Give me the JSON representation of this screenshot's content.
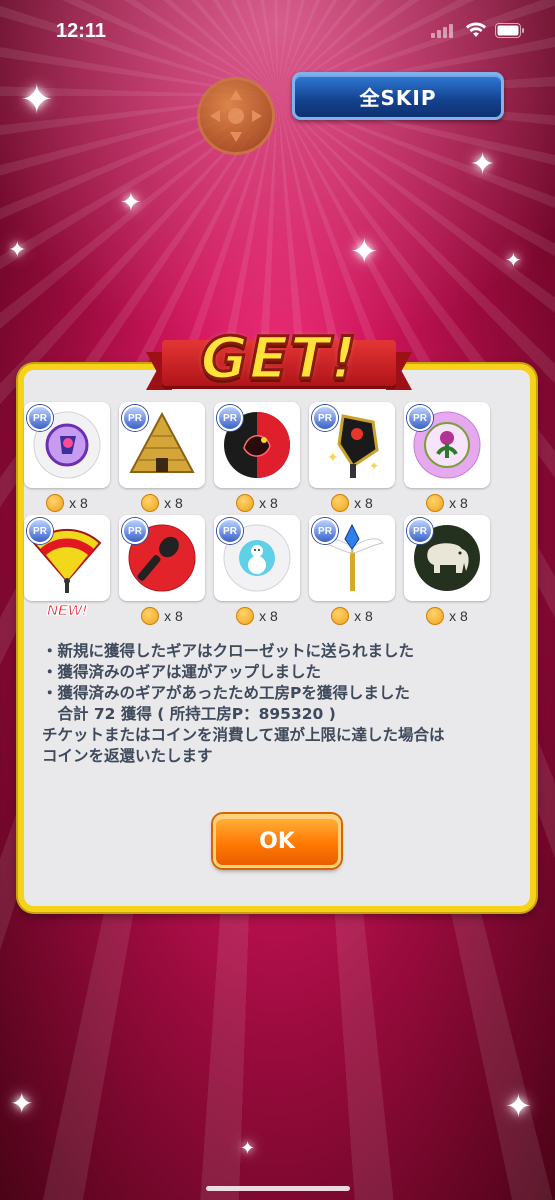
{
  "status_bar": {
    "time": "12:11"
  },
  "top": {
    "skip_label": "全SKIP"
  },
  "banner": {
    "text": "GET!"
  },
  "items": [
    {
      "icon": "golf-ball-purple-crest-icon",
      "badge": "PR",
      "coin_text": "x 8",
      "is_new": false
    },
    {
      "icon": "pyramid-icon",
      "badge": "PR",
      "coin_text": "x 8",
      "is_new": false
    },
    {
      "icon": "golf-ball-red-black-rooster-icon",
      "badge": "PR",
      "coin_text": "x 8",
      "is_new": false
    },
    {
      "icon": "golf-club-driver-icon",
      "badge": "PR",
      "coin_text": "x 8",
      "is_new": false
    },
    {
      "icon": "golf-ball-thistle-icon",
      "badge": "PR",
      "coin_text": "x 8",
      "is_new": false
    },
    {
      "icon": "folding-fan-icon",
      "badge": "PR",
      "coin_text": "",
      "is_new": true,
      "new_label": "NEW!"
    },
    {
      "icon": "golf-ball-microphone-icon",
      "badge": "PR",
      "coin_text": "x 8",
      "is_new": false
    },
    {
      "icon": "golf-ball-snowman-icon",
      "badge": "PR",
      "coin_text": "x 8",
      "is_new": false
    },
    {
      "icon": "winged-wand-icon",
      "badge": "PR",
      "coin_text": "x 8",
      "is_new": false
    },
    {
      "icon": "golf-ball-elephant-icon",
      "badge": "PR",
      "coin_text": "x 8",
      "is_new": false
    }
  ],
  "message": {
    "lines": [
      "・新規に獲得したギアはクローゼットに送られました",
      "・獲得済みのギアは運がアップしました",
      "・獲得済みのギアがあったため工房Pを獲得しました",
      "　合計 72 獲得 ( 所持工房P：895320 )",
      "チケットまたはコインを消費して運が上限に達した場合は",
      "コインを返還いたします"
    ]
  },
  "ok_label": "OK",
  "colors": {
    "panel_border": "#f6d21a",
    "panel_bg": "#e9e8ea",
    "ok_button": "#ff7a05",
    "skip_button": "#14418f",
    "new_badge": "#e8101a"
  }
}
